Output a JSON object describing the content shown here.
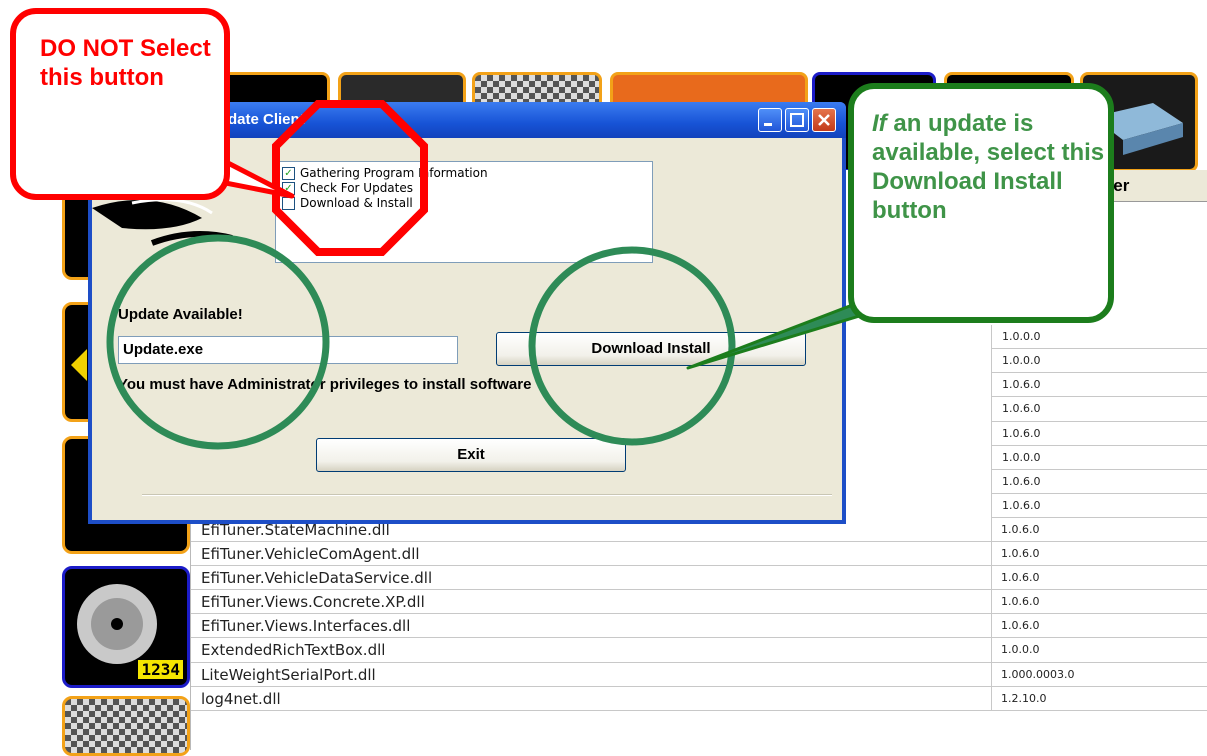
{
  "dialog": {
    "title": "Update Client",
    "steps": [
      {
        "label": "Gathering Program Information",
        "checked": true
      },
      {
        "label": "Check For Updates",
        "checked": true
      },
      {
        "label": "Download & Install",
        "checked": false
      }
    ],
    "status_label": "Update Available!",
    "file_field_value": "Update.exe",
    "download_button_label": "Download  Install",
    "admin_notice": "You must have Administrator privileges to install software",
    "exit_button_label": "Exit"
  },
  "callouts": {
    "red_text": "DO NOT Select this button",
    "green_prefix": "If",
    "green_text": " an update is available, select this Download Install button",
    "red_color": "#ff0000",
    "green_color": "#1c7d1c"
  },
  "table": {
    "version_column_header": "Version Number",
    "top_versions": [
      "1.0.0.0",
      "1.0.0.0",
      "1.0.6.0",
      "1.0.6.0",
      "1.0.6.0",
      "1.0.0.0",
      "1.0.6.0",
      "1.0.6.0"
    ],
    "rows": [
      {
        "name": "EfiTuner.StateMachine.dll",
        "version": "1.0.6.0"
      },
      {
        "name": "EfiTuner.VehicleComAgent.dll",
        "version": "1.0.6.0"
      },
      {
        "name": "EfiTuner.VehicleDataService.dll",
        "version": "1.0.6.0"
      },
      {
        "name": "EfiTuner.Views.Concrete.XP.dll",
        "version": "1.0.6.0"
      },
      {
        "name": "EfiTuner.Views.Interfaces.dll",
        "version": "1.0.6.0"
      },
      {
        "name": "ExtendedRichTextBox.dll",
        "version": "1.0.0.0"
      },
      {
        "name": "LiteWeightSerialPort.dll",
        "version": "1.000.0003.0"
      },
      {
        "name": "log4net.dll",
        "version": "1.2.10.0"
      }
    ]
  },
  "sidebar": {
    "disc_badge": "1234"
  }
}
